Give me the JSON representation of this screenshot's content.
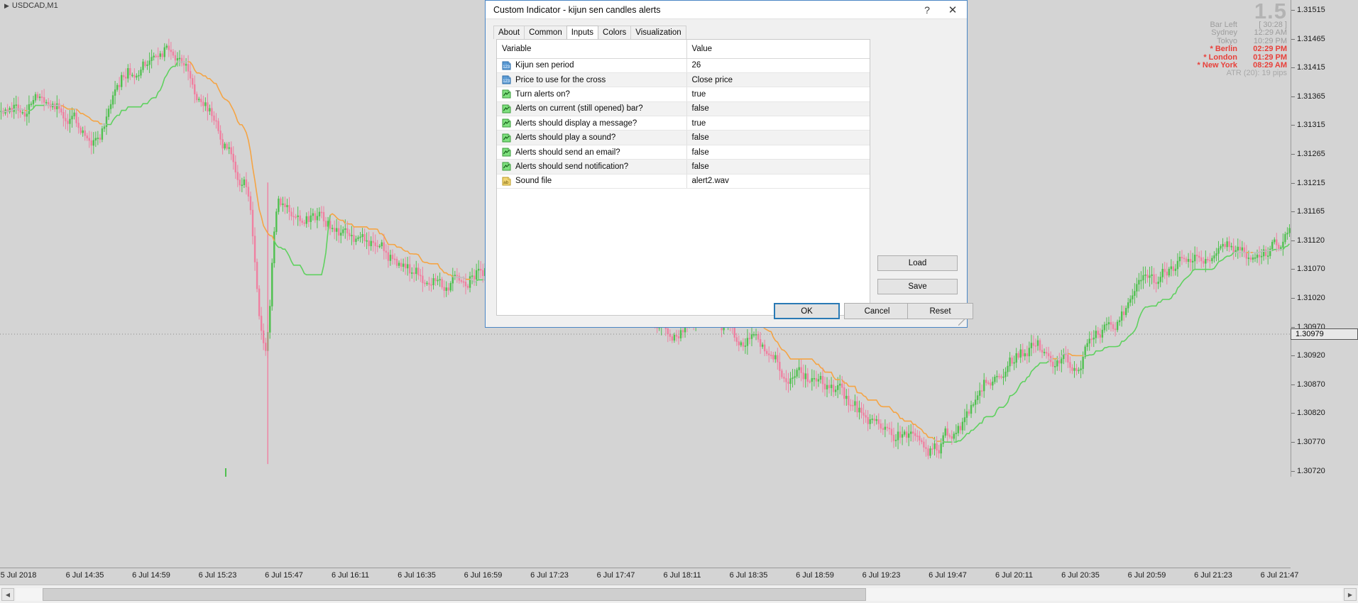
{
  "chart": {
    "symbol_label": "USDCAD,M1",
    "current_price": "1.30979",
    "price_ticks": [
      "1.31515",
      "1.31465",
      "1.31415",
      "1.31365",
      "1.31315",
      "1.31265",
      "1.31215",
      "1.31165",
      "1.31120",
      "1.31070",
      "1.31020",
      "1.30970",
      "1.30920",
      "1.30870",
      "1.30820",
      "1.30770",
      "1.30720"
    ],
    "time_ticks": [
      "5 Jul 2018",
      "6 Jul 14:35",
      "6 Jul 14:59",
      "6 Jul 15:23",
      "6 Jul 15:47",
      "6 Jul 16:11",
      "6 Jul 16:35",
      "6 Jul 16:59",
      "6 Jul 17:23",
      "6 Jul 17:47",
      "6 Jul 18:11",
      "6 Jul 18:35",
      "6 Jul 18:59",
      "6 Jul 19:23",
      "6 Jul 19:47",
      "6 Jul 20:11",
      "6 Jul 20:35",
      "6 Jul 20:59",
      "6 Jul 21:23",
      "6 Jul 21:47"
    ],
    "colors": {
      "background": "#d4d4d4",
      "bull_candle": "#4fc04f",
      "bear_candle": "#f07fa0",
      "kijun_orange": "#f5a444",
      "kijun_gray": "#bdbdbd",
      "kijun_green": "#5fd15f"
    }
  },
  "clock_panel": {
    "headline": "1.5",
    "rows": [
      {
        "label": "Bar Left",
        "value": "[ 30:28 ]",
        "hot": false
      },
      {
        "label": "Sydney",
        "value": "12:29 AM",
        "hot": false
      },
      {
        "label": "Tokyo",
        "value": "10:29 PM",
        "hot": false
      },
      {
        "label": "* Berlin",
        "value": "02:29 PM",
        "hot": true
      },
      {
        "label": "* London",
        "value": "01:29 PM",
        "hot": true
      },
      {
        "label": "* New York",
        "value": "08:29 AM",
        "hot": true
      }
    ],
    "atr": "ATR (20): 19 pips"
  },
  "dialog": {
    "title": "Custom Indicator - kijun sen candles alerts",
    "help_icon": "?",
    "close_icon": "✕",
    "tabs": [
      {
        "label": "About",
        "active": false
      },
      {
        "label": "Common",
        "active": false
      },
      {
        "label": "Inputs",
        "active": true
      },
      {
        "label": "Colors",
        "active": false
      },
      {
        "label": "Visualization",
        "active": false
      }
    ],
    "table": {
      "headers": [
        "Variable",
        "Value"
      ],
      "rows": [
        {
          "icon": "number-icon",
          "variable": "Kijun sen period",
          "value": "26"
        },
        {
          "icon": "number-icon",
          "variable": "Price to use for the cross",
          "value": "Close price"
        },
        {
          "icon": "boolean-icon",
          "variable": "Turn alerts on?",
          "value": "true"
        },
        {
          "icon": "boolean-icon",
          "variable": "Alerts on current (still opened) bar?",
          "value": "false"
        },
        {
          "icon": "boolean-icon",
          "variable": "Alerts should display a message?",
          "value": "true"
        },
        {
          "icon": "boolean-icon",
          "variable": "Alerts should play a sound?",
          "value": "false"
        },
        {
          "icon": "boolean-icon",
          "variable": "Alerts should send an email?",
          "value": "false"
        },
        {
          "icon": "boolean-icon",
          "variable": "Alerts should send notification?",
          "value": "false"
        },
        {
          "icon": "string-icon",
          "variable": "Sound file",
          "value": "alert2.wav"
        }
      ]
    },
    "side_buttons": {
      "load": "Load",
      "save": "Save"
    },
    "footer_buttons": {
      "ok": "OK",
      "cancel": "Cancel",
      "reset": "Reset"
    }
  }
}
